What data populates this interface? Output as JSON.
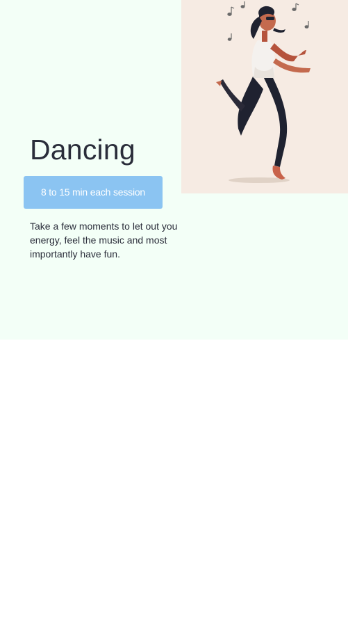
{
  "activity": {
    "title": "Dancing",
    "session_label": "8 to 15 min each session",
    "description": "Take a few moments to let out you energy, feel the music and most importantly have fun."
  },
  "colors": {
    "hero_background": "#f3fff7",
    "illustration_background": "#f6ebe3",
    "button": "#8bc4f2",
    "text": "#2a2d3a"
  },
  "illustration": {
    "subject": "dancing-woman-illustration",
    "decorations": [
      "music-note-icon"
    ]
  }
}
